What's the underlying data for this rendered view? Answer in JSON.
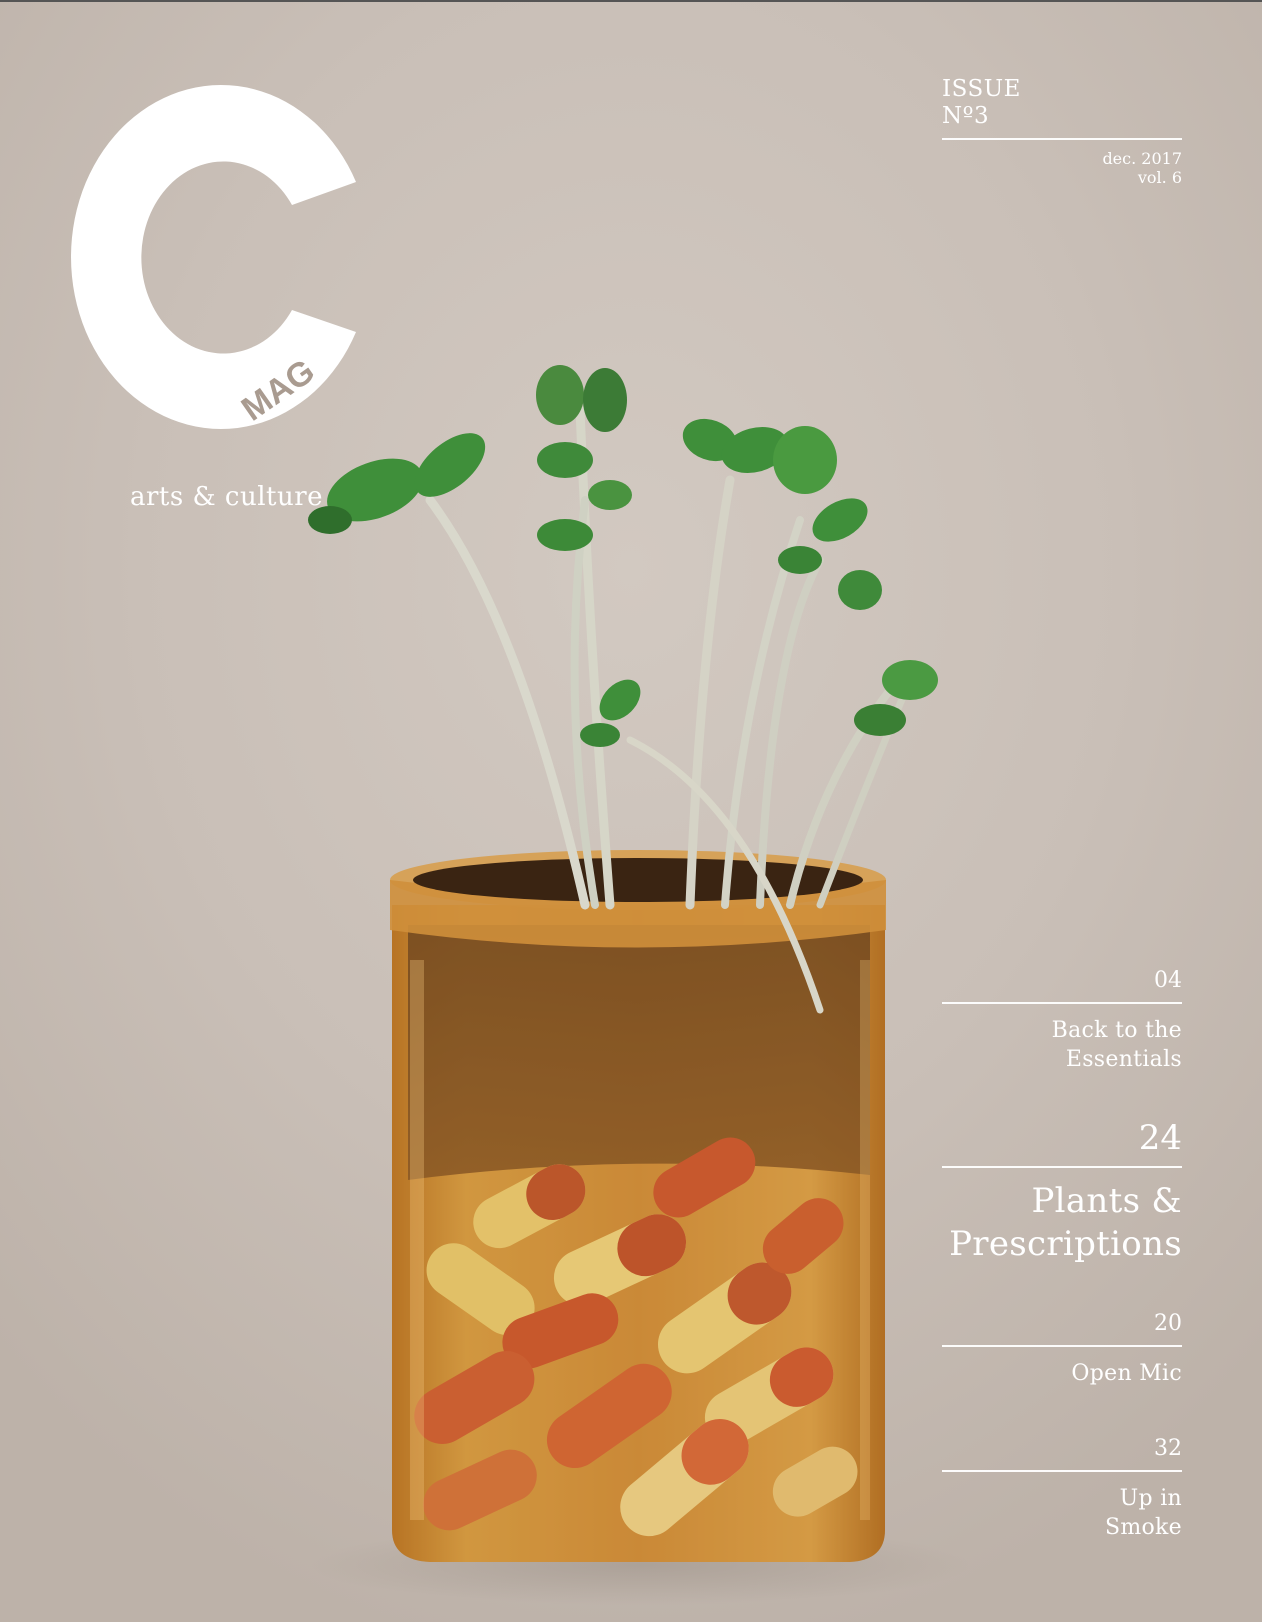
{
  "masthead": {
    "logo_letter": "C",
    "logo_sub": "MAG",
    "tagline": "arts & culture"
  },
  "issue": {
    "label": "ISSUE",
    "number": "Nº3",
    "date": "dec. 2017",
    "volume": "vol. 6"
  },
  "contents": [
    {
      "page": "04",
      "title_lines": [
        "Back to the",
        "Essentials"
      ],
      "featured": false
    },
    {
      "page": "24",
      "title_lines": [
        "Plants &",
        "Prescriptions"
      ],
      "featured": true
    },
    {
      "page": "20",
      "title_lines": [
        "Open Mic"
      ],
      "featured": false
    },
    {
      "page": "32",
      "title_lines": [
        "Up in",
        "Smoke"
      ],
      "featured": false
    }
  ],
  "colors": {
    "background": "#c8beb6",
    "text": "#ffffff",
    "jar": "#c9892e",
    "leaf": "#3f8f3a"
  }
}
